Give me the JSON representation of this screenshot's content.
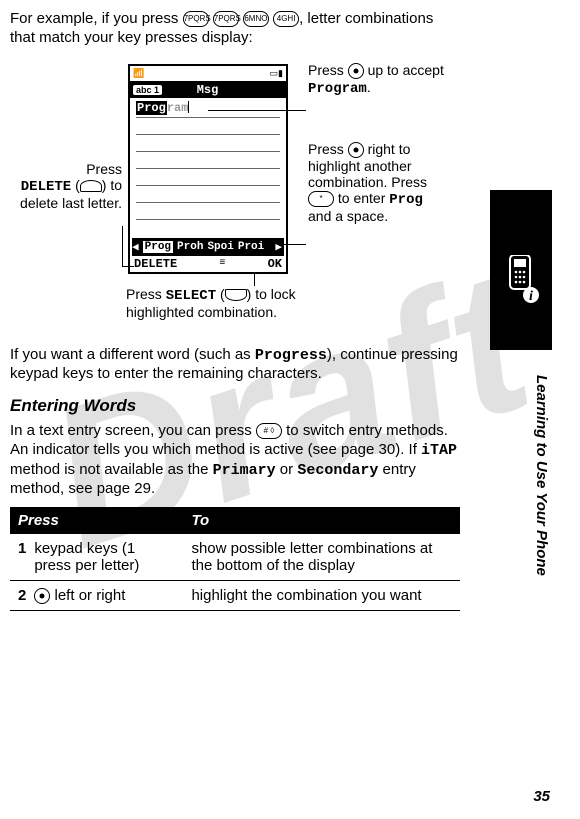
{
  "intro": {
    "prefix": "For example, if you press ",
    "keys": [
      "7PQRS",
      "7PQRS",
      "6MNO",
      "4GHI"
    ],
    "suffix": ", letter combinations that match your key presses display:"
  },
  "diagram": {
    "phone": {
      "mode": "abc 1",
      "title": "Msg",
      "entered_highlight": "Prog",
      "entered_grey": "ram",
      "suggestions": [
        "Prog",
        "Proh",
        "Spoi",
        "Proi"
      ],
      "soft_left": "DELETE",
      "soft_right": "OK",
      "menu_glyph": "≡"
    },
    "callouts": {
      "top_right_1": "Press ",
      "top_right_2": " up to accept ",
      "top_right_word": "Program",
      "top_right_3": ".",
      "right_1a": "Press ",
      "right_1b": " right to highlight another combination. Press ",
      "right_1c": " to enter ",
      "right_word": "Prog",
      "right_1d": " and a space.",
      "left_1a": "Press",
      "left_1b": "DELETE",
      "left_1c": " (",
      "left_1d": ") to delete last letter.",
      "bottom_1a": "Press ",
      "bottom_1b": "SELECT",
      "bottom_1c": " (",
      "bottom_1d": ") to lock highlighted combination."
    }
  },
  "para2_a": "If you want a different word (such as ",
  "para2_word": "Progress",
  "para2_b": "), continue pressing keypad keys to enter the remaining characters.",
  "heading": "Entering Words",
  "para3_a": "In a text entry screen, you can press ",
  "para3_key": "#",
  "para3_b": " to switch entry methods. An indicator tells you which method is active (see page 30). If ",
  "para3_itap": "iTAP",
  "para3_c": " method is not available as the ",
  "para3_primary": "Primary",
  "para3_d": " or ",
  "para3_secondary": "Secondary",
  "para3_e": " entry method, see page 29.",
  "table": {
    "head_press": "Press",
    "head_to": "To",
    "rows": [
      {
        "n": "1",
        "press": "keypad keys (1 press per letter)",
        "to": "show possible letter combinations at the bottom of the display"
      },
      {
        "n": "2",
        "press_prefix": " left or right",
        "to": " highlight the combination you want",
        "use_nav": true
      }
    ]
  },
  "side_text": "Learning to Use Your Phone",
  "page_number": "35"
}
